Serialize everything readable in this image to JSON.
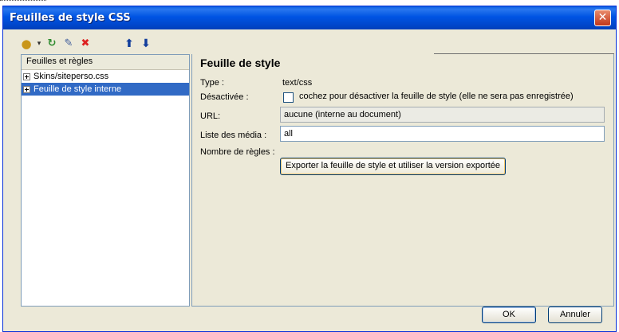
{
  "window": {
    "title": "Feuilles de style CSS",
    "close_glyph": "✕"
  },
  "toolbar": {
    "icons": [
      "palette-icon",
      "dropdown-arrow-icon",
      "refresh-icon",
      "edit-icon",
      "delete-icon",
      "arrow-up-icon",
      "arrow-down-icon"
    ]
  },
  "tree": {
    "header": "Feuilles et règles",
    "items": [
      {
        "label": "Skins/siteperso.css",
        "selected": false
      },
      {
        "label": "Feuille de style interne",
        "selected": true
      }
    ]
  },
  "details": {
    "title": "Feuille de style",
    "type_label": "Type :",
    "type_value": "text/css",
    "disabled_label": "Désactivée :",
    "disabled_checkbox_text": "cochez pour désactiver la feuille de style (elle ne sera pas enregistrée)",
    "disabled_checked": false,
    "url_label": "URL:",
    "url_value": "aucune (interne au document)",
    "media_label": "Liste des média :",
    "media_value": "all",
    "rules_label": "Nombre de règles :",
    "export_button": "Exporter la feuille de style et utiliser la version exportée"
  },
  "buttons": {
    "ok": "OK",
    "cancel": "Annuler"
  },
  "colors": {
    "titlebar": "#0054e3",
    "selection": "#316ac5",
    "dialog_bg": "#ece9d8"
  }
}
